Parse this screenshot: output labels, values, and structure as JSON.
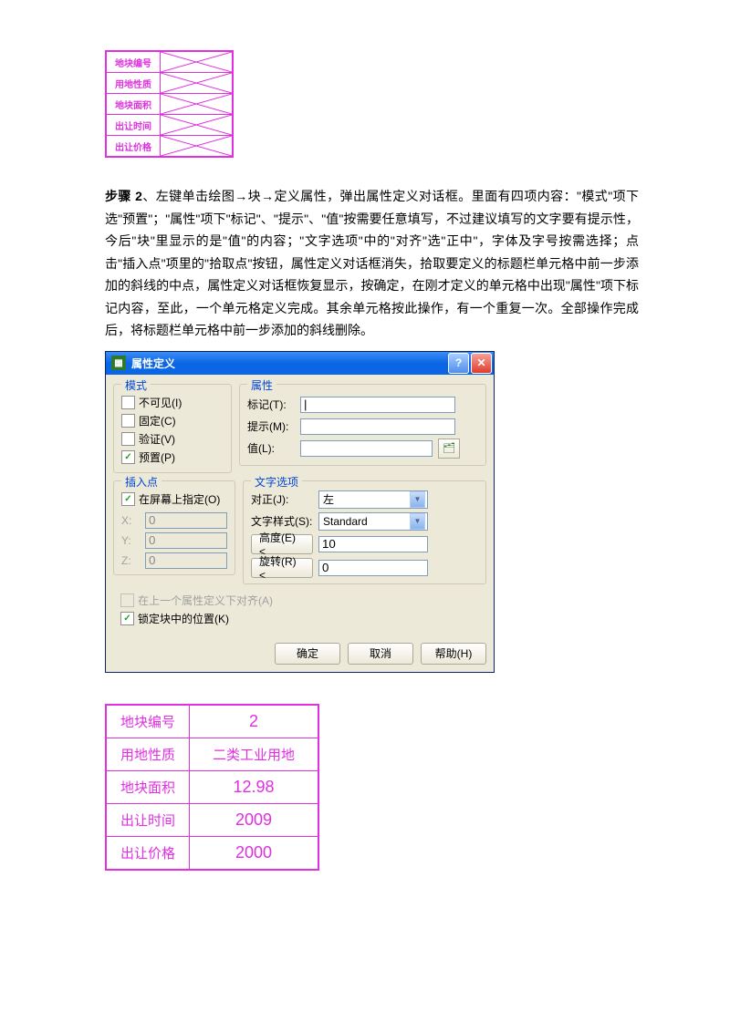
{
  "topTable": {
    "rows": [
      "地块编号",
      "用地性质",
      "地块面积",
      "出让时间",
      "出让价格"
    ]
  },
  "paragraph": {
    "label": "步骤 2",
    "text": "、左键单击绘图→块→定义属性，弹出属性定义对话框。里面有四项内容：\"模式\"项下选\"预置\"；\"属性\"项下\"标记\"、\"提示\"、\"值\"按需要任意填写，不过建议填写的文字要有提示性，今后\"块\"里显示的是\"值\"的内容；\"文字选项\"中的\"对齐\"选\"正中\"，字体及字号按需选择；点击\"插入点\"项里的\"拾取点\"按钮，属性定义对话框消失，拾取要定义的标题栏单元格中前一步添加的斜线的中点，属性定义对话框恢复显示，按确定，在刚才定义的单元格中出现\"属性\"项下标记内容，至此，一个单元格定义完成。其余单元格按此操作，有一个重复一次。全部操作完成后，将标题栏单元格中前一步添加的斜线删除。"
  },
  "dialog": {
    "title": "属性定义",
    "help": "?",
    "close": "✕",
    "mode": {
      "legend": "模式",
      "invisible": "不可见(I)",
      "constant": "固定(C)",
      "verify": "验证(V)",
      "preset": "预置(P)"
    },
    "attribute": {
      "legend": "属性",
      "tag": "标记(T):",
      "prompt": "提示(M):",
      "value": "值(L):",
      "tagVal": "|",
      "promptVal": "",
      "valueVal": ""
    },
    "insert": {
      "legend": "插入点",
      "onscreen": "在屏幕上指定(O)",
      "x": "X:",
      "xv": "0",
      "y": "Y:",
      "yv": "0",
      "z": "Z:",
      "zv": "0"
    },
    "textopts": {
      "legend": "文字选项",
      "justify": "对正(J):",
      "justifyVal": "左",
      "style": "文字样式(S):",
      "styleVal": "Standard",
      "height": "高度(E) <",
      "heightVal": "10",
      "rotation": "旋转(R) <",
      "rotationVal": "0"
    },
    "alignBelow": "在上一个属性定义下对齐(A)",
    "lockPos": "锁定块中的位置(K)",
    "ok": "确定",
    "cancel": "取消",
    "helpBtn": "帮助(H)"
  },
  "bottomTable": {
    "rows": [
      {
        "label": "地块编号",
        "value": "2",
        "cn": false
      },
      {
        "label": "用地性质",
        "value": "二类工业用地",
        "cn": true
      },
      {
        "label": "地块面积",
        "value": "12.98",
        "cn": false
      },
      {
        "label": "出让时间",
        "value": "2009",
        "cn": false
      },
      {
        "label": "出让价格",
        "value": "2000",
        "cn": false
      }
    ]
  }
}
